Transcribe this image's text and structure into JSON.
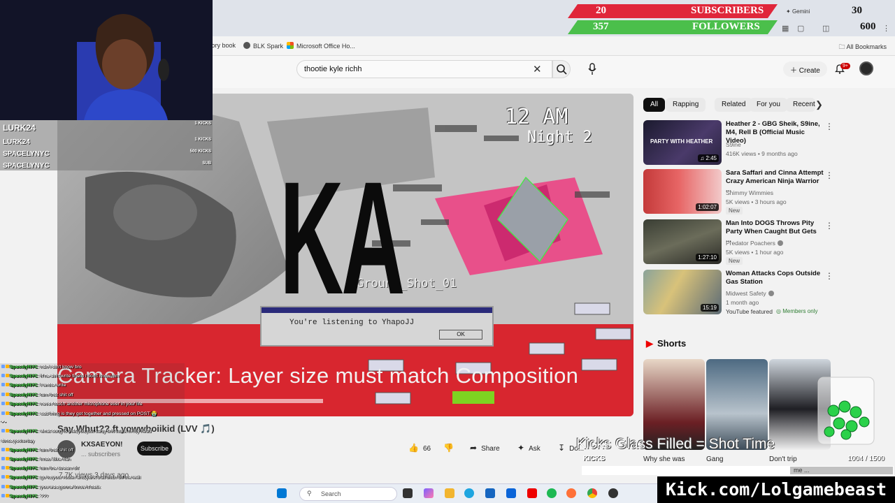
{
  "browser": {
    "bookmarks": [
      {
        "label": "tory book",
        "color": "#e65100"
      },
      {
        "label": "BLK Spark",
        "color": "#555555"
      },
      {
        "label": "Microsoft Office Ho...",
        "color": "#f25022"
      }
    ],
    "all_bookmarks": "All Bookmarks",
    "top_right_label": "Gemini"
  },
  "youtube": {
    "search_value": "thootie kyle richh",
    "create_label": "Create",
    "notification_count": "9+",
    "chips": [
      "All",
      "Rapping",
      "Related",
      "For you",
      "Recent"
    ],
    "video": {
      "overlay_big": "KA",
      "overlay_time": "12 AM",
      "overlay_night": "Night 2",
      "overlay_ground": "Ground_Shot_01",
      "overlay_tracker": "Camera Tracker: Layer size must match Composition",
      "dialog_message": "You're listening to YhapoJJ",
      "dialog_ok": "OK",
      "title": "Say Whut?? ft yowwboiikid (LVV 🎵)",
      "channel": "KXSAEYON!",
      "subscribers": "... subscribers",
      "subscribe_label": "Subscribe",
      "views": "7.7K views  3 days ago",
      "likes": "66",
      "share_label": "Share",
      "ask_label": "Ask",
      "download_label": "Do..."
    },
    "recommendations": [
      {
        "title": "Heather 2 - GBG Sheik, S9ine, M4, Rell B (Official Music Video)",
        "channel": "S9ine",
        "meta": "416K views • 9 months ago",
        "duration": "2:45",
        "thumb_text": "PARTY WITH HEATHER",
        "badge": ""
      },
      {
        "title": "Sara Saffari and Cinna Attempt Crazy American Ninja Warrior ...",
        "channel": "Shimmy Wimmies",
        "meta": "5K views • 3 hours ago",
        "duration": "1:02:07",
        "badge": "New"
      },
      {
        "title": "Man Into DOGS Throws Pity Party When Caught But Gets ...",
        "channel": "Predator Poachers",
        "meta": "5K views • 1 hour ago",
        "duration": "1:27:10",
        "badge": "New"
      },
      {
        "title": "Woman Attacks Cops Outside Gas Station",
        "channel": "Midwest Safety",
        "meta": "1 month ago",
        "duration": "15:19",
        "badge": "YouTube featured",
        "members": "Members only"
      }
    ],
    "shorts_header": "Shorts",
    "shorts": [
      "Why she was",
      "Gang",
      "Don't trip"
    ]
  },
  "stream": {
    "alerts": [
      {
        "name": "LURK24",
        "value": "1 KICKS"
      },
      {
        "name": "LURK24",
        "value": "1 KICKS"
      },
      {
        "name": "SPACELYNYC",
        "value": "500 KICKS"
      },
      {
        "name": "SPACELYNYC",
        "value": "SUB"
      }
    ],
    "goals": [
      {
        "current": "20",
        "label": "SUBSCRIBERS",
        "target": "30",
        "color": "#e0263a"
      },
      {
        "current": "357",
        "label": "FOLLOWERS",
        "target": "600",
        "color": "#4bbf4b"
      }
    ],
    "chat": [
      {
        "user": "SpacelyNYC",
        "msg": ": nah I ain't know bro"
      },
      {
        "user": "SpacelyNYC",
        "msg": ": if he ain't write fineto I don't know him"
      },
      {
        "user": "SpacelyNYC",
        "msg": ": I wrote write"
      },
      {
        "user": "SpacelyNYC",
        "msg": ": turn that shit off"
      },
      {
        "user": "SpacelyNYC",
        "msg": ": never touch another microphone ever in your life"
      },
      {
        "user": "SpacelyNYC",
        "msg": ": sad thing is they got together and pressed on POST 😭"
      },
      {
        "user": "",
        "msg": "• •"
      },
      {
        "user": "SpacelyNYC",
        "msg": ": what song is that you just sang shit stuck in my head"
      },
      {
        "user": "",
        "msg": "since yesterday"
      },
      {
        "user": "SpacelyNYC",
        "msg": ": turn that shit off"
      },
      {
        "user": "SpacelyNYC",
        "msg": ": lmao Sike nah"
      },
      {
        "user": "SpacelyNYC",
        "msg": ": turn the stream off"
      },
      {
        "user": "SpacelyNYC",
        "msg": ": go to your router and yank that bitch off the wall"
      },
      {
        "user": "SpacelyNYC",
        "msg": ": you was gonna throw it back"
      },
      {
        "user": "SpacelyNYC",
        "msg": ": ???"
      }
    ],
    "kicks_title": "Kicks Glass Filled =  Shot Time",
    "kicks_label": "KICKS",
    "kicks_count": "1004  /  1500",
    "kicks_fraction": 0.669,
    "kicks_extra": "me ...",
    "kick_url": "Kick.com/Lolgamebeast"
  },
  "taskbar": {
    "search_placeholder": "Search"
  }
}
